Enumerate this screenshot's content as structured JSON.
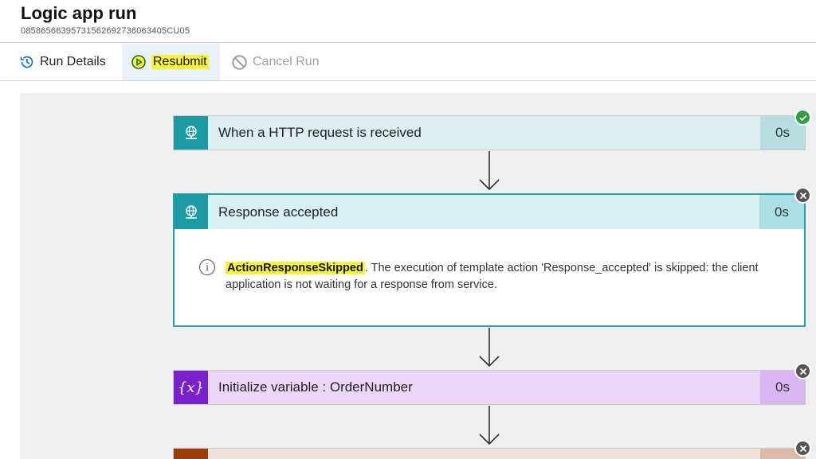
{
  "header": {
    "title": "Logic app run",
    "run_id": "08586566395731562692736063405CU05"
  },
  "toolbar": {
    "run_details": "Run Details",
    "resubmit": "Resubmit",
    "cancel_run": "Cancel Run"
  },
  "steps": {
    "http": {
      "label": "When a HTTP request is received",
      "duration": "0s"
    },
    "response": {
      "label": "Response accepted",
      "duration": "0s",
      "error_code": "ActionResponseSkipped",
      "error_message": ". The execution of template action 'Response_accepted' is skipped: the client application is not waiting for a response from service."
    },
    "variable": {
      "icon_text": "{x}",
      "label": "Initialize variable : OrderNumber",
      "duration": "0s"
    }
  },
  "colors": {
    "http": "#1d9aa3",
    "variable": "#7a22c9",
    "success": "#2f9e41",
    "highlight": "#f8f43a"
  }
}
